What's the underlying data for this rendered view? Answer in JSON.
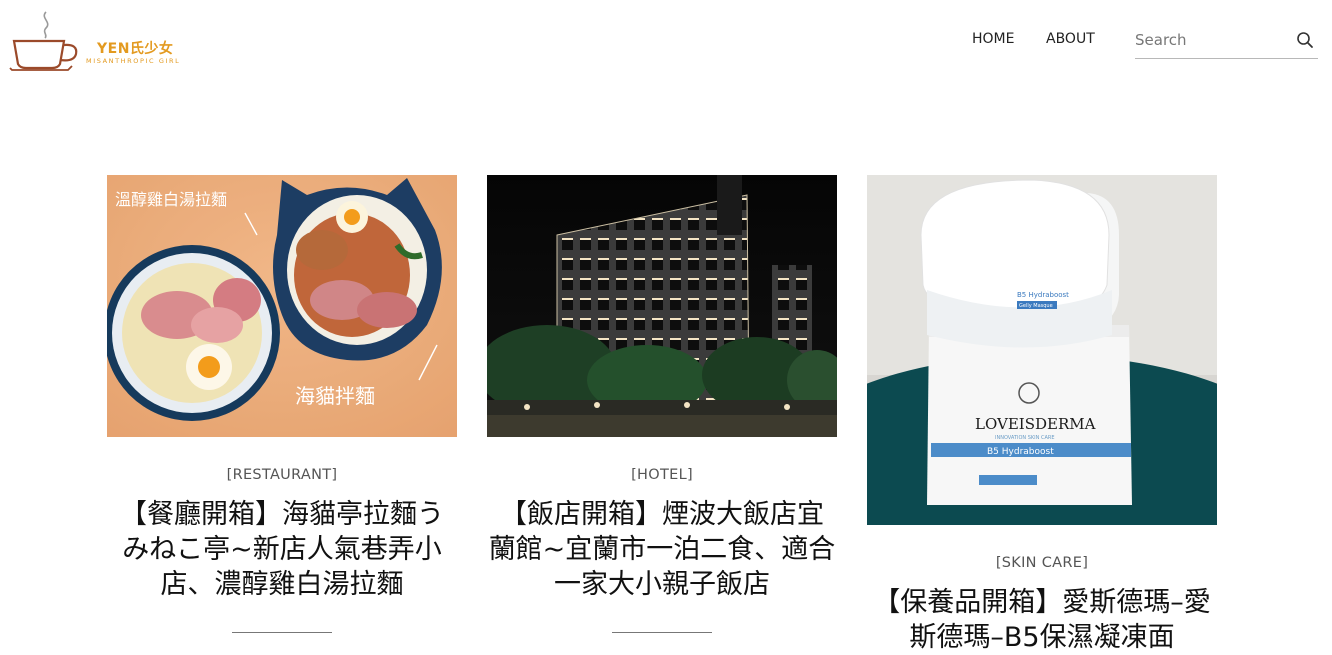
{
  "header": {
    "logo_name": "YEN氏少女",
    "logo_tagline": "MISANTHROPIC GIRL",
    "nav": {
      "home": "HOME",
      "about": "ABOUT"
    },
    "search": {
      "placeholder": "Search",
      "value": "",
      "icon": "search-icon"
    }
  },
  "colors": {
    "brand": "#e39a20",
    "logo_cup": "#9b4a2a",
    "text": "#111111",
    "muted": "#555555"
  },
  "posts": [
    {
      "category": "[RESTAURANT]",
      "title": "【餐廳開箱】海貓亭拉麵うみねこ亭~新店人氣巷弄小店、濃醇雞白湯拉麵",
      "image_text": {
        "top": "溫醇雞白湯拉麵",
        "bottom": "海貓拌麵"
      }
    },
    {
      "category": "[HOTEL]",
      "title": "【飯店開箱】煙波大飯店宜蘭館~宜蘭市一泊二食、適合一家大小親子飯店"
    },
    {
      "category": "[SKIN CARE]",
      "title": "【保養品開箱】愛斯德瑪–愛斯德瑪–B5保濕凝凍面",
      "image_text": {
        "brand": "LOVEISDERMA",
        "sub": "INNOVATION SKIN CARE",
        "product": "B5 Hydraboost",
        "type": "Gelly Masque"
      }
    }
  ]
}
